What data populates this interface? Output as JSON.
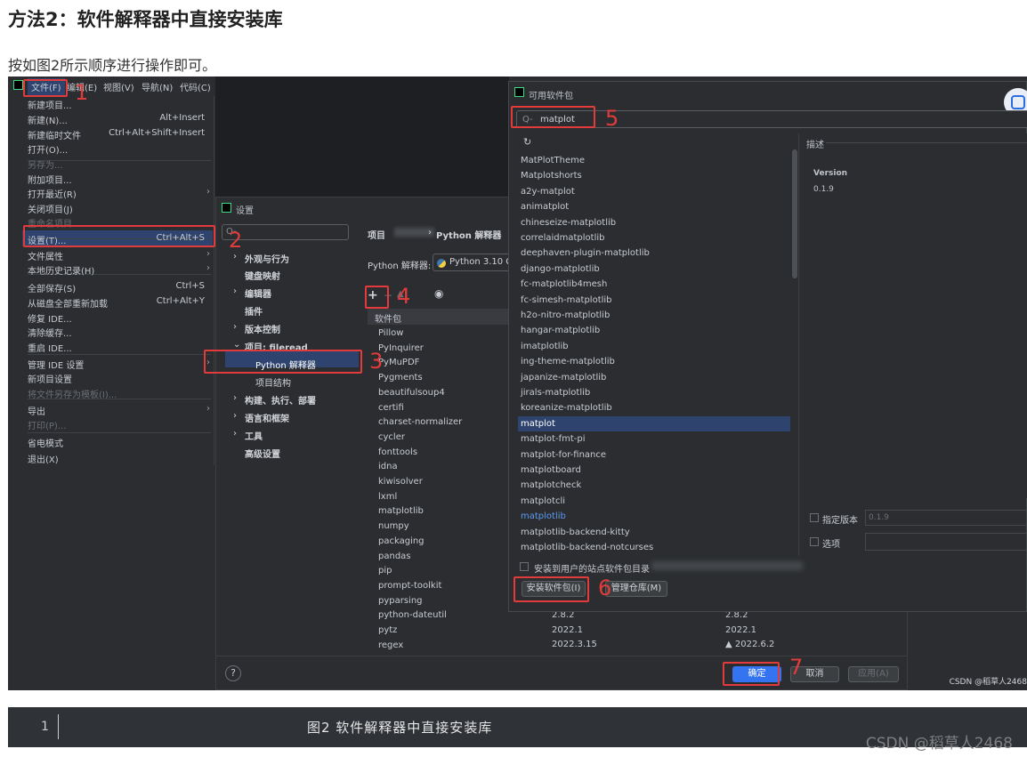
{
  "article": {
    "heading": "方法2：软件解释器中直接安装库",
    "intro": "按如图2所示顺序进行操作即可。"
  },
  "menubar": {
    "file": "文件(F)",
    "edit": "编辑(E)",
    "view": "视图(V)",
    "nav": "导航(N)",
    "code": "代码(C)"
  },
  "file_menu": [
    {
      "label": "新建项目..."
    },
    {
      "label": "新建(N)...",
      "shortcut": "Alt+Insert"
    },
    {
      "label": "新建临时文件",
      "shortcut": "Ctrl+Alt+Shift+Insert"
    },
    {
      "label": "打开(O)..."
    },
    {
      "label": "另存为..."
    },
    {
      "label": "附加项目..."
    },
    {
      "label": "打开最近(R)"
    },
    {
      "label": "关闭项目(J)"
    },
    {
      "label": "重命名项目..."
    },
    {
      "label": "设置(T)...",
      "shortcut": "Ctrl+Alt+S"
    },
    {
      "label": "文件属性"
    },
    {
      "label": "本地历史记录(H)"
    },
    {
      "label": "全部保存(S)",
      "shortcut": "Ctrl+S"
    },
    {
      "label": "从磁盘全部重新加载",
      "shortcut": "Ctrl+Alt+Y"
    },
    {
      "label": "修复 IDE..."
    },
    {
      "label": "清除缓存..."
    },
    {
      "label": "重启 IDE..."
    },
    {
      "label": "管理 IDE 设置"
    },
    {
      "label": "新项目设置"
    },
    {
      "label": "将文件另存为模板(I)..."
    },
    {
      "label": "导出"
    },
    {
      "label": "打印(P)..."
    },
    {
      "label": "省电模式"
    },
    {
      "label": "退出(X)"
    }
  ],
  "settings": {
    "title": "设置",
    "search_placeholder": "Q-",
    "nav": [
      "外观与行为",
      "键盘映射",
      "编辑器",
      "插件",
      "版本控制",
      "项目: fileread",
      "Python 解释器",
      "项目结构",
      "构建、执行、部署",
      "语言和框架",
      "工具",
      "高级设置"
    ],
    "breadcrumb_project": "项目",
    "breadcrumb_sep": "›",
    "breadcrumb_page": "Python 解释器",
    "interpreter_label": "Python 解释器:",
    "interpreter_value": "Python 3.10 C",
    "col_package": "软件包",
    "packages": [
      "Pillow",
      "PyInquirer",
      "PyMuPDF",
      "Pygments",
      "beautifulsoup4",
      "certifi",
      "charset-normalizer",
      "cycler",
      "fonttools",
      "idna",
      "kiwisolver",
      "lxml",
      "matplotlib",
      "numpy",
      "packaging",
      "pandas",
      "pip",
      "prompt-toolkit",
      "pyparsing",
      "python-dateutil",
      "pytz",
      "regex"
    ],
    "ver_rows": [
      {
        "v": "2.8.2",
        "l": "2.8.2"
      },
      {
        "v": "2022.1",
        "l": "2022.1"
      },
      {
        "v": "2022.3.15",
        "l": "▲ 2022.6.2"
      }
    ],
    "ok": "确定",
    "cancel": "取消",
    "apply": "应用(A)",
    "help": "?"
  },
  "dialog": {
    "title": "可用软件包",
    "search_value": "matplot",
    "search_icon": "Q-",
    "items": [
      "MatPlotTheme",
      "Matplotshorts",
      "a2y-matplot",
      "animatplot",
      "chineseize-matplotlib",
      "correlaidmatplotlib",
      "deephaven-plugin-matplotlib",
      "django-matplotlib",
      "fc-matplotlib4mesh",
      "fc-simesh-matplotlib",
      "h2o-nitro-matplotlib",
      "hangar-matplotlib",
      "imatplotlib",
      "ing-theme-matplotlib",
      "japanize-matplotlib",
      "jirals-matplotlib",
      "koreanize-matplotlib",
      "matplot",
      "matplot-fmt-pi",
      "matplot-for-finance",
      "matplotboard",
      "matplotcheck",
      "matplotcli",
      "matplotlib",
      "matplotlib-backend-kitty",
      "matplotlib-backend-notcurses"
    ],
    "desc_label": "描述",
    "version_label": "Version",
    "version_value": "0.1.9",
    "specify_version": "指定版本",
    "specify_value": "0.1.9",
    "options": "选项",
    "user_site": "安装到用户的站点软件包目录",
    "install_btn": "安装软件包(I)",
    "manage_btn": "管理仓库(M)"
  },
  "steps": [
    "1",
    "2",
    "3",
    "4",
    "5",
    "6",
    "7"
  ],
  "screenshot_watermark": "CSDN @稻草人2468",
  "footer": {
    "line": "1",
    "caption": "图2 软件解释器中直接安装库",
    "watermark": "CSDN @稻草人2468"
  }
}
